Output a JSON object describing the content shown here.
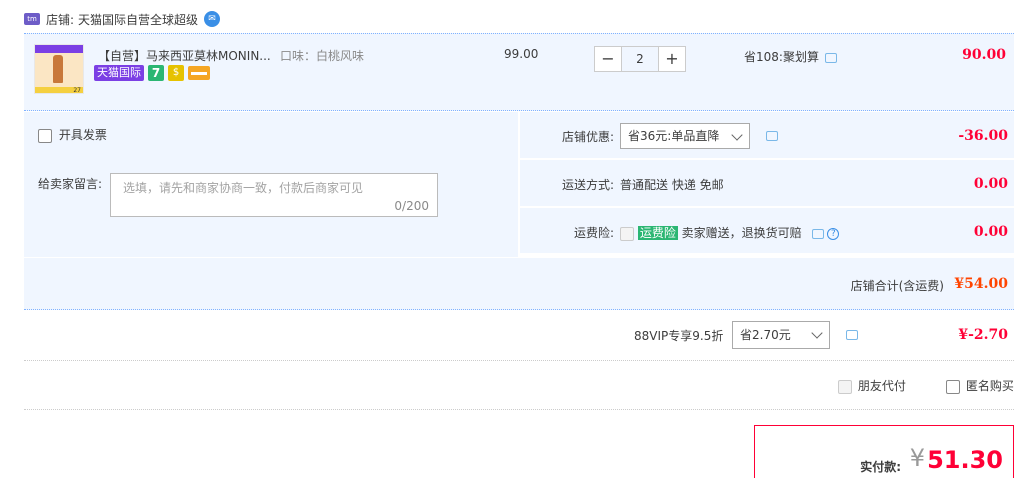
{
  "shop": {
    "label": "店铺:",
    "name": "天猫国际自营全球超级"
  },
  "item": {
    "title": "【自营】马来西亚莫林MONIN...",
    "sku": "口味：白桃风味",
    "badge_tmall_global": "天猫国际",
    "badge_7": "7",
    "thumb_num": "27",
    "unit_price": "99.00",
    "quantity": "2",
    "minus": "−",
    "plus": "+",
    "saving": "省108:聚划算",
    "total": "90.00"
  },
  "invoice": {
    "label": "开具发票"
  },
  "memo": {
    "label": "给卖家留言:",
    "placeholder": "选填，请先和商家协商一致，付款后商家可见",
    "counter": "0/200"
  },
  "shop_discount": {
    "label": "店铺优惠:",
    "selected": "省36元:单品直降",
    "amount": "-36.00"
  },
  "shipping": {
    "label": "运送方式:",
    "value": "普通配送 快递 免邮",
    "amount": "0.00"
  },
  "insurance": {
    "label": "运费险:",
    "badge": "运费险",
    "text": "卖家赠送，退换货可赔",
    "help": "?",
    "amount": "0.00"
  },
  "shop_total": {
    "label": "店铺合计(含运费)",
    "amount": "¥54.00"
  },
  "vip": {
    "label": "88VIP专享9.5折",
    "selected": "省2.70元",
    "amount": "¥-2.70"
  },
  "options": {
    "friend_pay": "朋友代付",
    "anonymous": "匿名购买"
  },
  "payment": {
    "label": "实付款:",
    "currency": "¥",
    "amount": "51.30"
  },
  "colors": {
    "accent_red": "#ff0036",
    "panel_bg": "#f0f6ff",
    "border_blue": "#80b2ff",
    "tmall_purple": "#7b3fe4"
  }
}
